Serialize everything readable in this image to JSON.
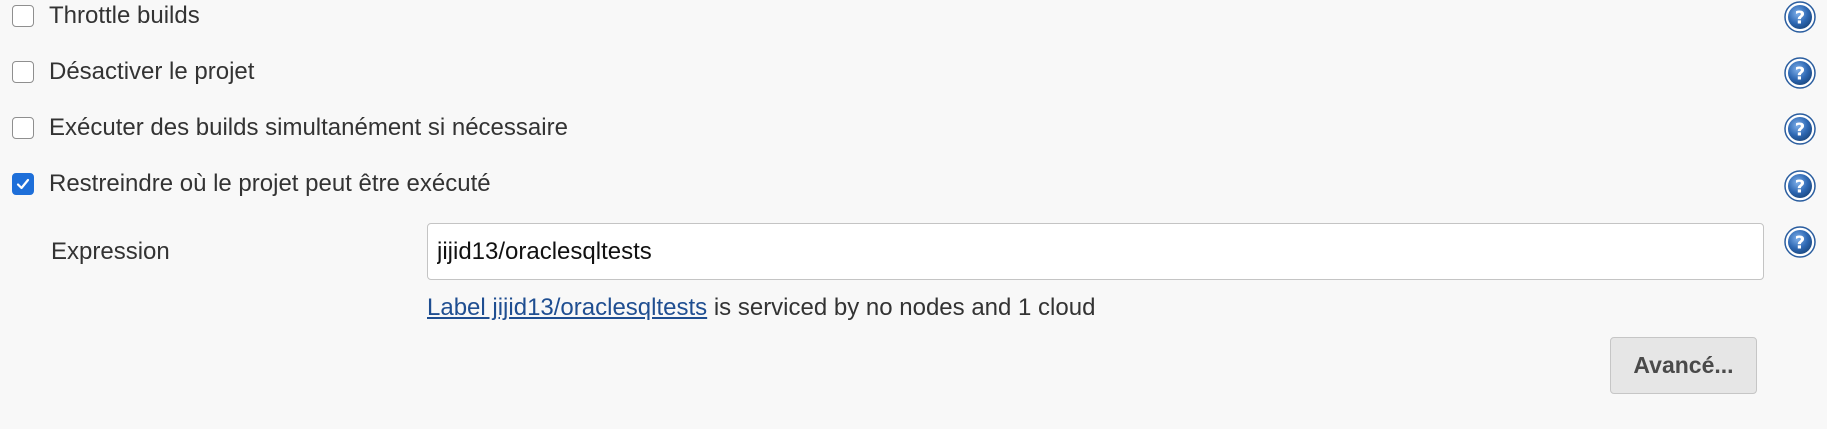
{
  "options": [
    {
      "label": "Throttle builds",
      "checked": false
    },
    {
      "label": "Désactiver le projet",
      "checked": false
    },
    {
      "label": "Exécuter des builds simultanément si nécessaire",
      "checked": false
    },
    {
      "label": "Restreindre où le projet peut être exécuté",
      "checked": true
    }
  ],
  "expression": {
    "label": "Expression",
    "value": "jijid13/oraclesqltests"
  },
  "status": {
    "link_text": "Label jijid13/oraclesqltests",
    "suffix_text": " is serviced by no nodes and 1 cloud"
  },
  "advanced_button": {
    "label": "Avancé..."
  },
  "icons": {
    "help": "help-icon",
    "check": "check-icon"
  },
  "colors": {
    "background": "#f8f8f8",
    "checkbox_checked": "#1e6fd9",
    "link": "#1f4e91",
    "help_icon": "#2e68b3"
  }
}
